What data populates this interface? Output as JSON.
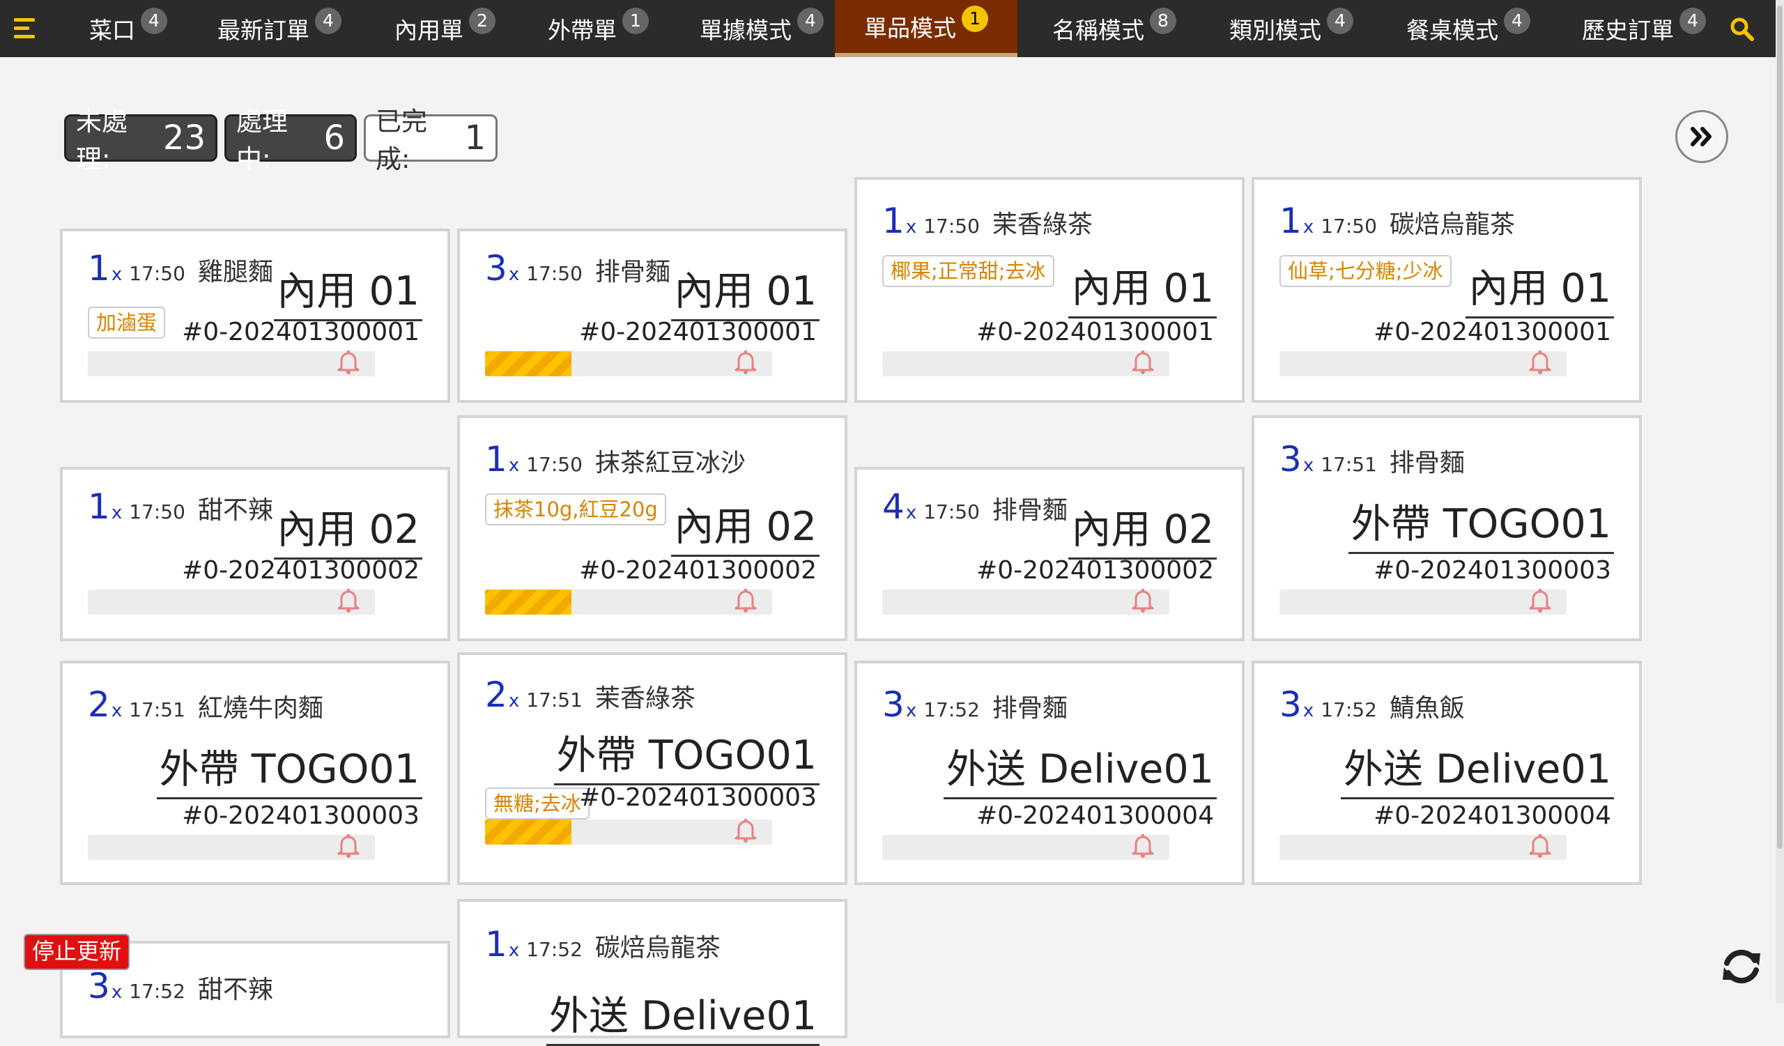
{
  "nav": {
    "tabs": [
      {
        "label": "菜口",
        "badge": "4"
      },
      {
        "label": "最新訂單",
        "badge": "4"
      },
      {
        "label": "內用單",
        "badge": "2"
      },
      {
        "label": "外帶單",
        "badge": "1"
      },
      {
        "label": "單據模式",
        "badge": "4"
      },
      {
        "label": "單品模式",
        "badge": "1",
        "active": true
      },
      {
        "label": "名稱模式",
        "badge": "8"
      },
      {
        "label": "類別模式",
        "badge": "4"
      },
      {
        "label": "餐桌模式",
        "badge": "4"
      },
      {
        "label": "歷史訂單",
        "badge": "4"
      }
    ],
    "menu_icon": "hamburger-menu-icon",
    "search_icon": "search-icon",
    "accent_color": "#f5c400",
    "active_color": "#7a2c00"
  },
  "status": {
    "pending_label": "未處理:",
    "pending_count": "23",
    "processing_label": "處理中:",
    "processing_count": "6",
    "done_label": "已完成:",
    "done_count": "1"
  },
  "cards": [
    {
      "qty": "1",
      "x": "x",
      "time": "17:50",
      "name": "雞腿麵",
      "note": "加滷蛋",
      "table": "內用 01",
      "order": "#0-202401300001",
      "progress": 0
    },
    {
      "qty": "3",
      "x": "x",
      "time": "17:50",
      "name": "排骨麵",
      "note": "",
      "table": "內用 01",
      "order": "#0-202401300001",
      "progress": 0.3
    },
    {
      "qty": "1",
      "x": "x",
      "time": "17:50",
      "name": "茉香綠茶",
      "note": "椰果;正常甜;去冰",
      "table": "內用 01",
      "order": "#0-202401300001",
      "progress": 0
    },
    {
      "qty": "1",
      "x": "x",
      "time": "17:50",
      "name": "碳焙烏龍茶",
      "note": "仙草;七分糖;少冰",
      "table": "內用 01",
      "order": "#0-202401300001",
      "progress": 0
    },
    {
      "qty": "1",
      "x": "x",
      "time": "17:50",
      "name": "甜不辣",
      "note": "",
      "table": "內用 02",
      "order": "#0-202401300002",
      "progress": 0
    },
    {
      "qty": "1",
      "x": "x",
      "time": "17:50",
      "name": "抹茶紅豆冰沙",
      "note": "抹茶10g,紅豆20g",
      "table": "內用 02",
      "order": "#0-202401300002",
      "progress": 0.3
    },
    {
      "qty": "4",
      "x": "x",
      "time": "17:50",
      "name": "排骨麵",
      "note": "",
      "table": "內用 02",
      "order": "#0-202401300002",
      "progress": 0
    },
    {
      "qty": "3",
      "x": "x",
      "time": "17:51",
      "name": "排骨麵",
      "note": "",
      "table": "外帶 TOGO01",
      "order": "#0-202401300003",
      "progress": 0
    },
    {
      "qty": "2",
      "x": "x",
      "time": "17:51",
      "name": "紅燒牛肉麵",
      "note": "",
      "table": "外帶 TOGO01",
      "order": "#0-202401300003",
      "progress": 0
    },
    {
      "qty": "2",
      "x": "x",
      "time": "17:51",
      "name": "茉香綠茶",
      "note": "無糖;去冰",
      "table": "外帶 TOGO01",
      "order": "#0-202401300003",
      "progress": 0.3
    },
    {
      "qty": "3",
      "x": "x",
      "time": "17:52",
      "name": "排骨麵",
      "note": "",
      "table": "外送 Delive01",
      "order": "#0-202401300004",
      "progress": 0
    },
    {
      "qty": "3",
      "x": "x",
      "time": "17:52",
      "name": "鯖魚飯",
      "note": "",
      "table": "外送 Delive01",
      "order": "#0-202401300004",
      "progress": 0
    },
    {
      "qty": "3",
      "x": "x",
      "time": "17:52",
      "name": "甜不辣",
      "note": "",
      "table": "",
      "order": "",
      "progress": 0
    },
    {
      "qty": "1",
      "x": "x",
      "time": "17:52",
      "name": "碳焙烏龍茶",
      "note": "",
      "table": "外送 Delive01",
      "order": "",
      "progress": 0
    }
  ],
  "footer": {
    "stop_label": "停止更新",
    "refresh_icon": "refresh-icon",
    "next_icon": "double-chevron-right-icon"
  }
}
